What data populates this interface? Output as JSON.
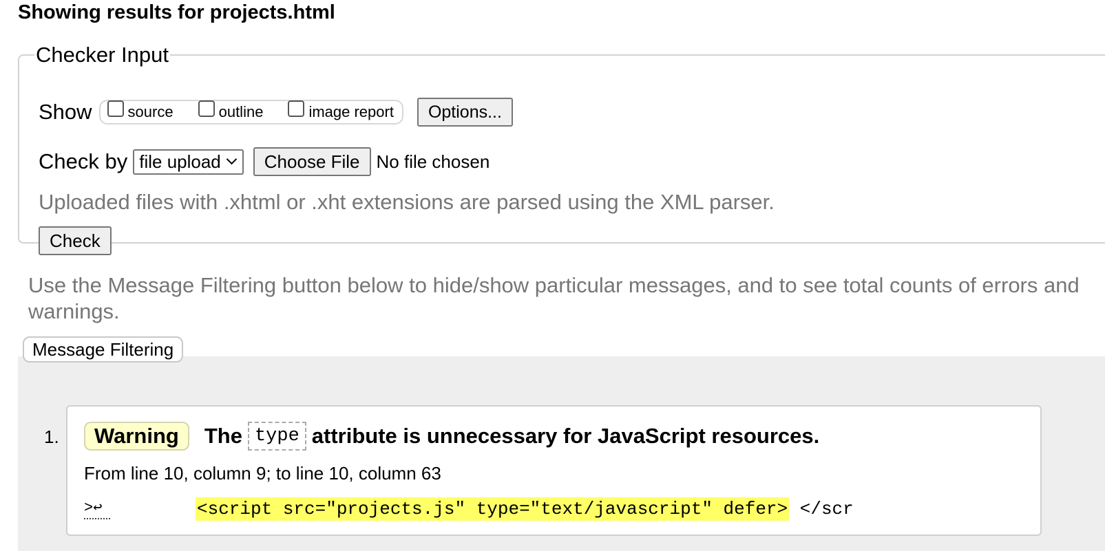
{
  "page": {
    "title": "Showing results for projects.html"
  },
  "checker": {
    "legend": "Checker Input",
    "show_label": "Show",
    "show_options": [
      {
        "label": "source",
        "checked": false
      },
      {
        "label": "outline",
        "checked": false
      },
      {
        "label": "image report",
        "checked": false
      }
    ],
    "options_button": "Options...",
    "check_by_label": "Check by",
    "check_by_selected": "file upload",
    "choose_file_button": "Choose File",
    "file_status": "No file chosen",
    "upload_note": "Uploaded files with .xhtml or .xht extensions are parsed using the XML parser.",
    "check_button": "Check"
  },
  "filter": {
    "note": "Use the Message Filtering button below to hide/show particular messages, and to see total counts of errors and warnings.",
    "button": "Message Filtering"
  },
  "messages": [
    {
      "number": "1.",
      "type": "Warning",
      "text_before": "The",
      "code": "type",
      "text_after": "attribute is unnecessary for JavaScript resources.",
      "location": "From line 10, column 9; to line 10, column 63",
      "extract_prefix": ">",
      "extract_icon": "↩",
      "extract_highlight": "<script src=\"projects.js\" type=\"text/javascript\" defer>",
      "extract_suffix": " </scr"
    }
  ],
  "colors": {
    "warning_badge_bg": "#ffffcc",
    "highlight_bg": "#ffff66",
    "results_panel_bg": "#eeeeee",
    "muted_text": "#767676"
  }
}
